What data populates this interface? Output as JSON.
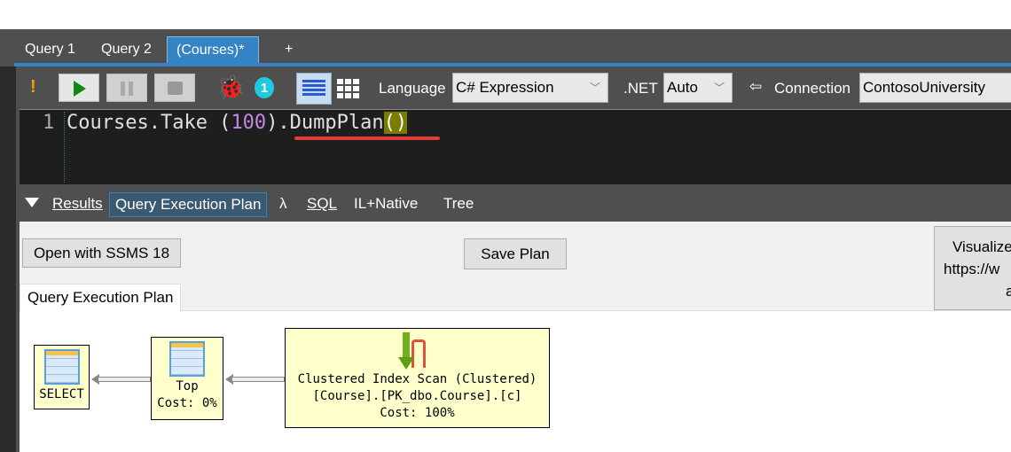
{
  "tabs": [
    {
      "label": "Query 1"
    },
    {
      "label": "Query 2"
    },
    {
      "label": "(Courses)*"
    },
    {
      "label": "+"
    }
  ],
  "toolbar": {
    "warning": "!",
    "language_label": "Language",
    "language_value": "C# Expression",
    "net_label": ".NET",
    "net_value": "Auto",
    "connection_arrow": "⇦",
    "connection_label": "Connection",
    "connection_value": "ContosoUniversity",
    "debug_badge": "1"
  },
  "editor": {
    "line_number": "1",
    "code_prefix": "Courses.Take (",
    "code_number": "100",
    "code_mid": ").DumpPlan",
    "code_parens": "()"
  },
  "result_tabs": {
    "results": "Results",
    "plan": "Query Execution Plan",
    "lambda": "λ",
    "sql": "SQL",
    "il": "IL+Native",
    "tree": "Tree"
  },
  "panel": {
    "open_ssms": "Open with SSMS 18",
    "save_plan": "Save Plan",
    "visualize_line1": "Visualize",
    "visualize_line2": "https://w",
    "visualize_line3": "a",
    "inner_tab": "Query Execution Plan"
  },
  "plan_nodes": [
    {
      "title": "SELECT"
    },
    {
      "title": "Top",
      "cost": "Cost: 0%"
    },
    {
      "title": "Clustered Index Scan (Clustered)",
      "object": "[Course].[PK_dbo.Course].[c]",
      "cost": "Cost: 100%"
    }
  ],
  "colors": {
    "accent": "#3582c4",
    "node_bg": "#ffffcc",
    "number": "#c586e8",
    "underline": "#e03c3c"
  }
}
